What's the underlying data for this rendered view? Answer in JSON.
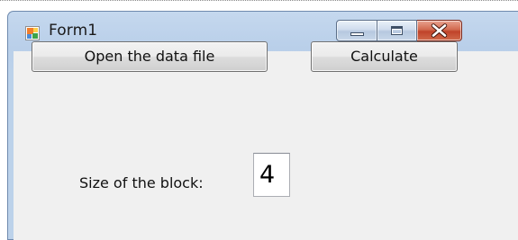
{
  "window": {
    "title": "Form1"
  },
  "title_controls": {
    "minimize_icon": "minimize-icon",
    "maximize_icon": "maximize-icon",
    "close_icon": "close-icon"
  },
  "buttons": {
    "open_label": "Open the data file",
    "calculate_label": "Calculate"
  },
  "block_size": {
    "label": "Size of the block:",
    "value": "4"
  },
  "colors": {
    "close_button": "#c84f33",
    "titlebar": "#bfd4ec",
    "client": "#f0f0f0"
  }
}
